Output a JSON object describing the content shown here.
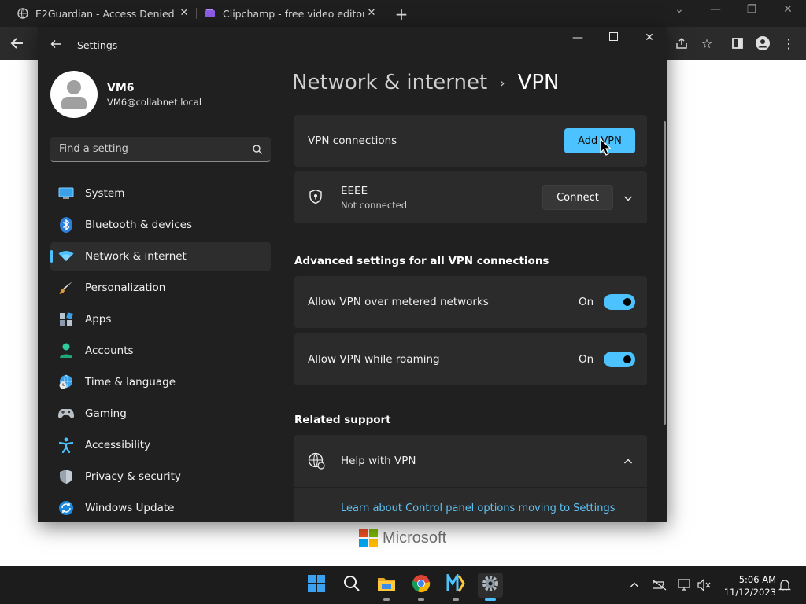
{
  "browser": {
    "tabs": [
      {
        "title": "E2Guardian - Access Denied"
      },
      {
        "title": "Clipchamp - free video editor & v"
      }
    ]
  },
  "page_background": {
    "logo_text": "Microsoft"
  },
  "settings": {
    "app_title": "Settings",
    "profile": {
      "name": "VM6",
      "email": "VM6@collabnet.local"
    },
    "search_placeholder": "Find a setting",
    "nav": [
      {
        "label": "System",
        "icon": "monitor-icon"
      },
      {
        "label": "Bluetooth & devices",
        "icon": "bluetooth-icon"
      },
      {
        "label": "Network & internet",
        "icon": "wifi-icon",
        "active": true
      },
      {
        "label": "Personalization",
        "icon": "brush-icon"
      },
      {
        "label": "Apps",
        "icon": "apps-icon"
      },
      {
        "label": "Accounts",
        "icon": "person-icon"
      },
      {
        "label": "Time & language",
        "icon": "globe-clock-icon"
      },
      {
        "label": "Gaming",
        "icon": "gamepad-icon"
      },
      {
        "label": "Accessibility",
        "icon": "accessibility-icon"
      },
      {
        "label": "Privacy & security",
        "icon": "shield-icon"
      },
      {
        "label": "Windows Update",
        "icon": "update-icon"
      }
    ],
    "breadcrumb": {
      "parent": "Network & internet",
      "separator": "›",
      "current": "VPN"
    },
    "vpn_connections": {
      "label": "VPN connections",
      "add_button": "Add VPN"
    },
    "vpn_entry": {
      "name": "EEEE",
      "status": "Not connected",
      "connect_button": "Connect"
    },
    "advanced": {
      "title": "Advanced settings for all VPN connections",
      "settings": [
        {
          "label": "Allow VPN over metered networks",
          "state": "On"
        },
        {
          "label": "Allow VPN while roaming",
          "state": "On"
        }
      ]
    },
    "related": {
      "title": "Related support",
      "help_label": "Help with VPN",
      "link": "Learn about Control panel options moving to Settings"
    }
  },
  "taskbar": {
    "time": "5:06 AM",
    "date": "11/12/2023"
  },
  "colors": {
    "accent": "#4cc2ff",
    "window_bg": "#202020",
    "card_bg": "#2b2b2b"
  }
}
